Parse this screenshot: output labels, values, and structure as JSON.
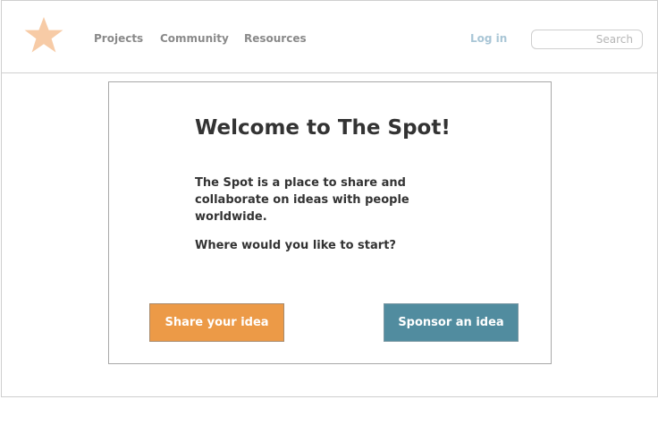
{
  "header": {
    "nav": {
      "projects": "Projects",
      "community": "Community",
      "resources": "Resources"
    },
    "login_label": "Log in",
    "search": {
      "placeholder": "Search",
      "value": ""
    }
  },
  "welcome": {
    "title": "Welcome to The Spot!",
    "description": "The Spot is a place to share and collaborate on ideas with people worldwide.",
    "question": "Where would you like to start?",
    "share_button": "Share your idea",
    "sponsor_button": "Sponsor an idea"
  },
  "colors": {
    "logo_star": "#f7cba6",
    "nav_text": "#8a8a8a",
    "login_text": "#a9c6d6",
    "share_button_bg": "#ec9a47",
    "sponsor_button_bg": "#518c9f",
    "heading_text": "#333333"
  },
  "icons": {
    "logo": "star-logo-icon"
  }
}
